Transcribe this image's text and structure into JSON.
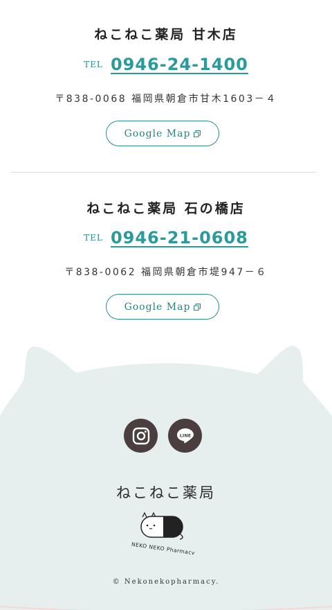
{
  "stores": [
    {
      "name": "ねこねこ薬局 甘木店",
      "tel_label": "TEL",
      "tel_number": "0946-24-1400",
      "address": "〒838-0068 福岡県朝倉市甘木1603－４",
      "map_label": "Google Map"
    },
    {
      "name": "ねこねこ薬局 石の橋店",
      "tel_label": "TEL",
      "tel_number": "0946-21-0608",
      "address": "〒838-0062 福岡県朝倉市堤947－６",
      "map_label": "Google Map"
    }
  ],
  "footer": {
    "social": [
      {
        "name": "instagram",
        "icon": "instagram-icon"
      },
      {
        "name": "line",
        "icon": "line-icon",
        "text": "LINE"
      }
    ],
    "brand_name": "ねこねこ薬局",
    "logo_text": "NEKO NEKO Pharmacy",
    "copyright": "© Nekonekopharmacy."
  },
  "colors": {
    "accent": "#2a9a9a",
    "footer_bg": "#e6efee",
    "social_bg": "#4a3e3e"
  }
}
